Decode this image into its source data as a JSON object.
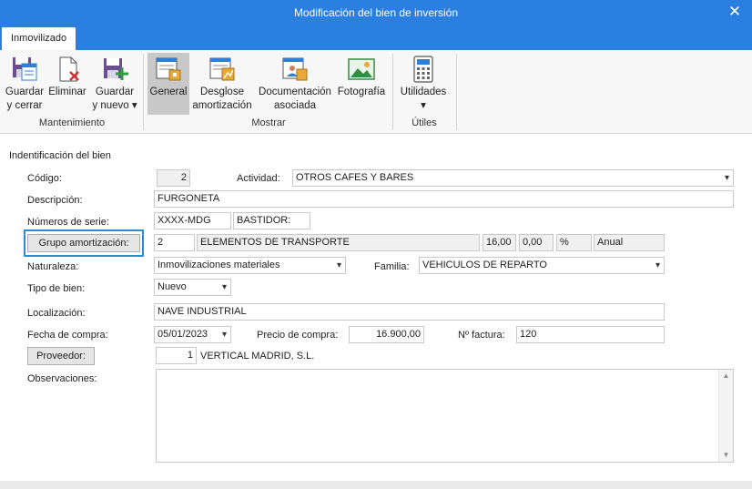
{
  "window": {
    "title": "Modificación del bien de inversión"
  },
  "tabs": [
    {
      "label": "Inmovilizado"
    }
  ],
  "ribbon": {
    "guardar_cerrar": [
      "Guardar",
      "y cerrar"
    ],
    "eliminar": "Eliminar",
    "guardar_nuevo": [
      "Guardar",
      "y nuevo ▾"
    ],
    "general": "General",
    "desglose": [
      "Desglose",
      "amortización"
    ],
    "documentacion": [
      "Documentación",
      "asociada"
    ],
    "fotografia": "Fotografía",
    "utilidades": [
      "Utilidades",
      "▾"
    ],
    "groups": {
      "mantenimiento": "Mantenimiento",
      "mostrar": "Mostrar",
      "utiles": "Útiles"
    }
  },
  "form": {
    "section_title": "Indentificación del bien",
    "codigo_label": "Código:",
    "codigo": "2",
    "actividad_label": "Actividad:",
    "actividad": "OTROS CAFES Y BARES",
    "descripcion_label": "Descripción:",
    "descripcion": "FURGONETA",
    "series_label": "Números de serie:",
    "serie1": "XXXX-MDG",
    "serie2": "BASTIDOR:",
    "grupo_button": "Grupo amortización:",
    "grupo_code": "2",
    "grupo_name": "ELEMENTOS DE TRANSPORTE",
    "grupo_pct1": "16,00",
    "grupo_pct2": "0,00",
    "grupo_unit": "%",
    "grupo_period": "Anual",
    "naturaleza_label": "Naturaleza:",
    "naturaleza": "Inmovilizaciones materiales",
    "familia_label": "Familia:",
    "familia": "VEHICULOS DE REPARTO",
    "tipo_label": "Tipo de bien:",
    "tipo": "Nuevo",
    "localizacion_label": "Localización:",
    "localizacion": "NAVE INDUSTRIAL",
    "fecha_label": "Fecha de compra:",
    "fecha": "05/01/2023",
    "precio_label": "Precio de compra:",
    "precio": "16.900,00",
    "factura_label": "Nº factura:",
    "factura": "120",
    "proveedor_button": "Proveedor:",
    "proveedor_code": "1",
    "proveedor_name": "VERTICAL MADRID, S.L.",
    "observaciones_label": "Observaciones:"
  },
  "icons": {
    "close": "close-icon",
    "save_close": "save-close-icon",
    "delete": "delete-icon",
    "save_new": "save-new-icon",
    "general": "general-form-icon",
    "breakdown": "amortization-breakdown-icon",
    "docs": "documents-icon",
    "photo": "photo-icon",
    "utilities": "calculator-icon"
  },
  "colors": {
    "titlebar": "#2b7fe0",
    "focus": "#2d8bcf",
    "active_ribbon": "#c8c8c8"
  }
}
